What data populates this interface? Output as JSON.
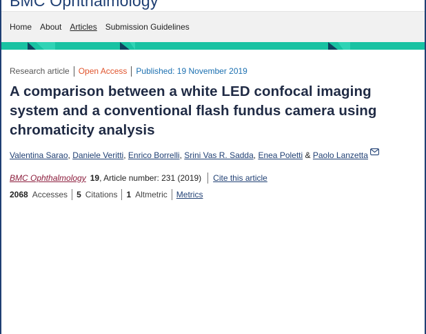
{
  "brand": {
    "name": "BMC Ophthalmology"
  },
  "nav": {
    "items": [
      {
        "label": "Home"
      },
      {
        "label": "About"
      },
      {
        "label": "Articles",
        "active": true
      },
      {
        "label": "Submission Guidelines"
      }
    ]
  },
  "colors": {
    "accent_band": "#18c2a2",
    "brand_blue": "#1f3f73",
    "open_access": "#e0542d",
    "journal_link": "#8b1c3b"
  },
  "article": {
    "type": "Research article",
    "access": "Open Access",
    "published": "Published: 19 November 2019",
    "title": "A comparison between a white LED confocal imaging system and a conventional flash fundus camera using chromaticity analysis",
    "authors": [
      "Valentina Sarao",
      "Daniele Veritti",
      "Enrico Borrelli",
      "Srini Vas R. Sadda",
      "Enea Poletti",
      "Paolo Lanzetta"
    ],
    "authors_and": "&",
    "journal": "BMC Ophthalmology",
    "volume": "19",
    "article_number": ", Article number: 231 (2019)",
    "cite_label": "Cite this article"
  },
  "metrics": {
    "accesses_count": "2068",
    "accesses_label": "Accesses",
    "citations_count": "5",
    "citations_label": "Citations",
    "altmetric_count": "1",
    "altmetric_label": "Altmetric",
    "metrics_link": "Metrics"
  },
  "icons": {
    "author_contact": "mail-icon"
  }
}
